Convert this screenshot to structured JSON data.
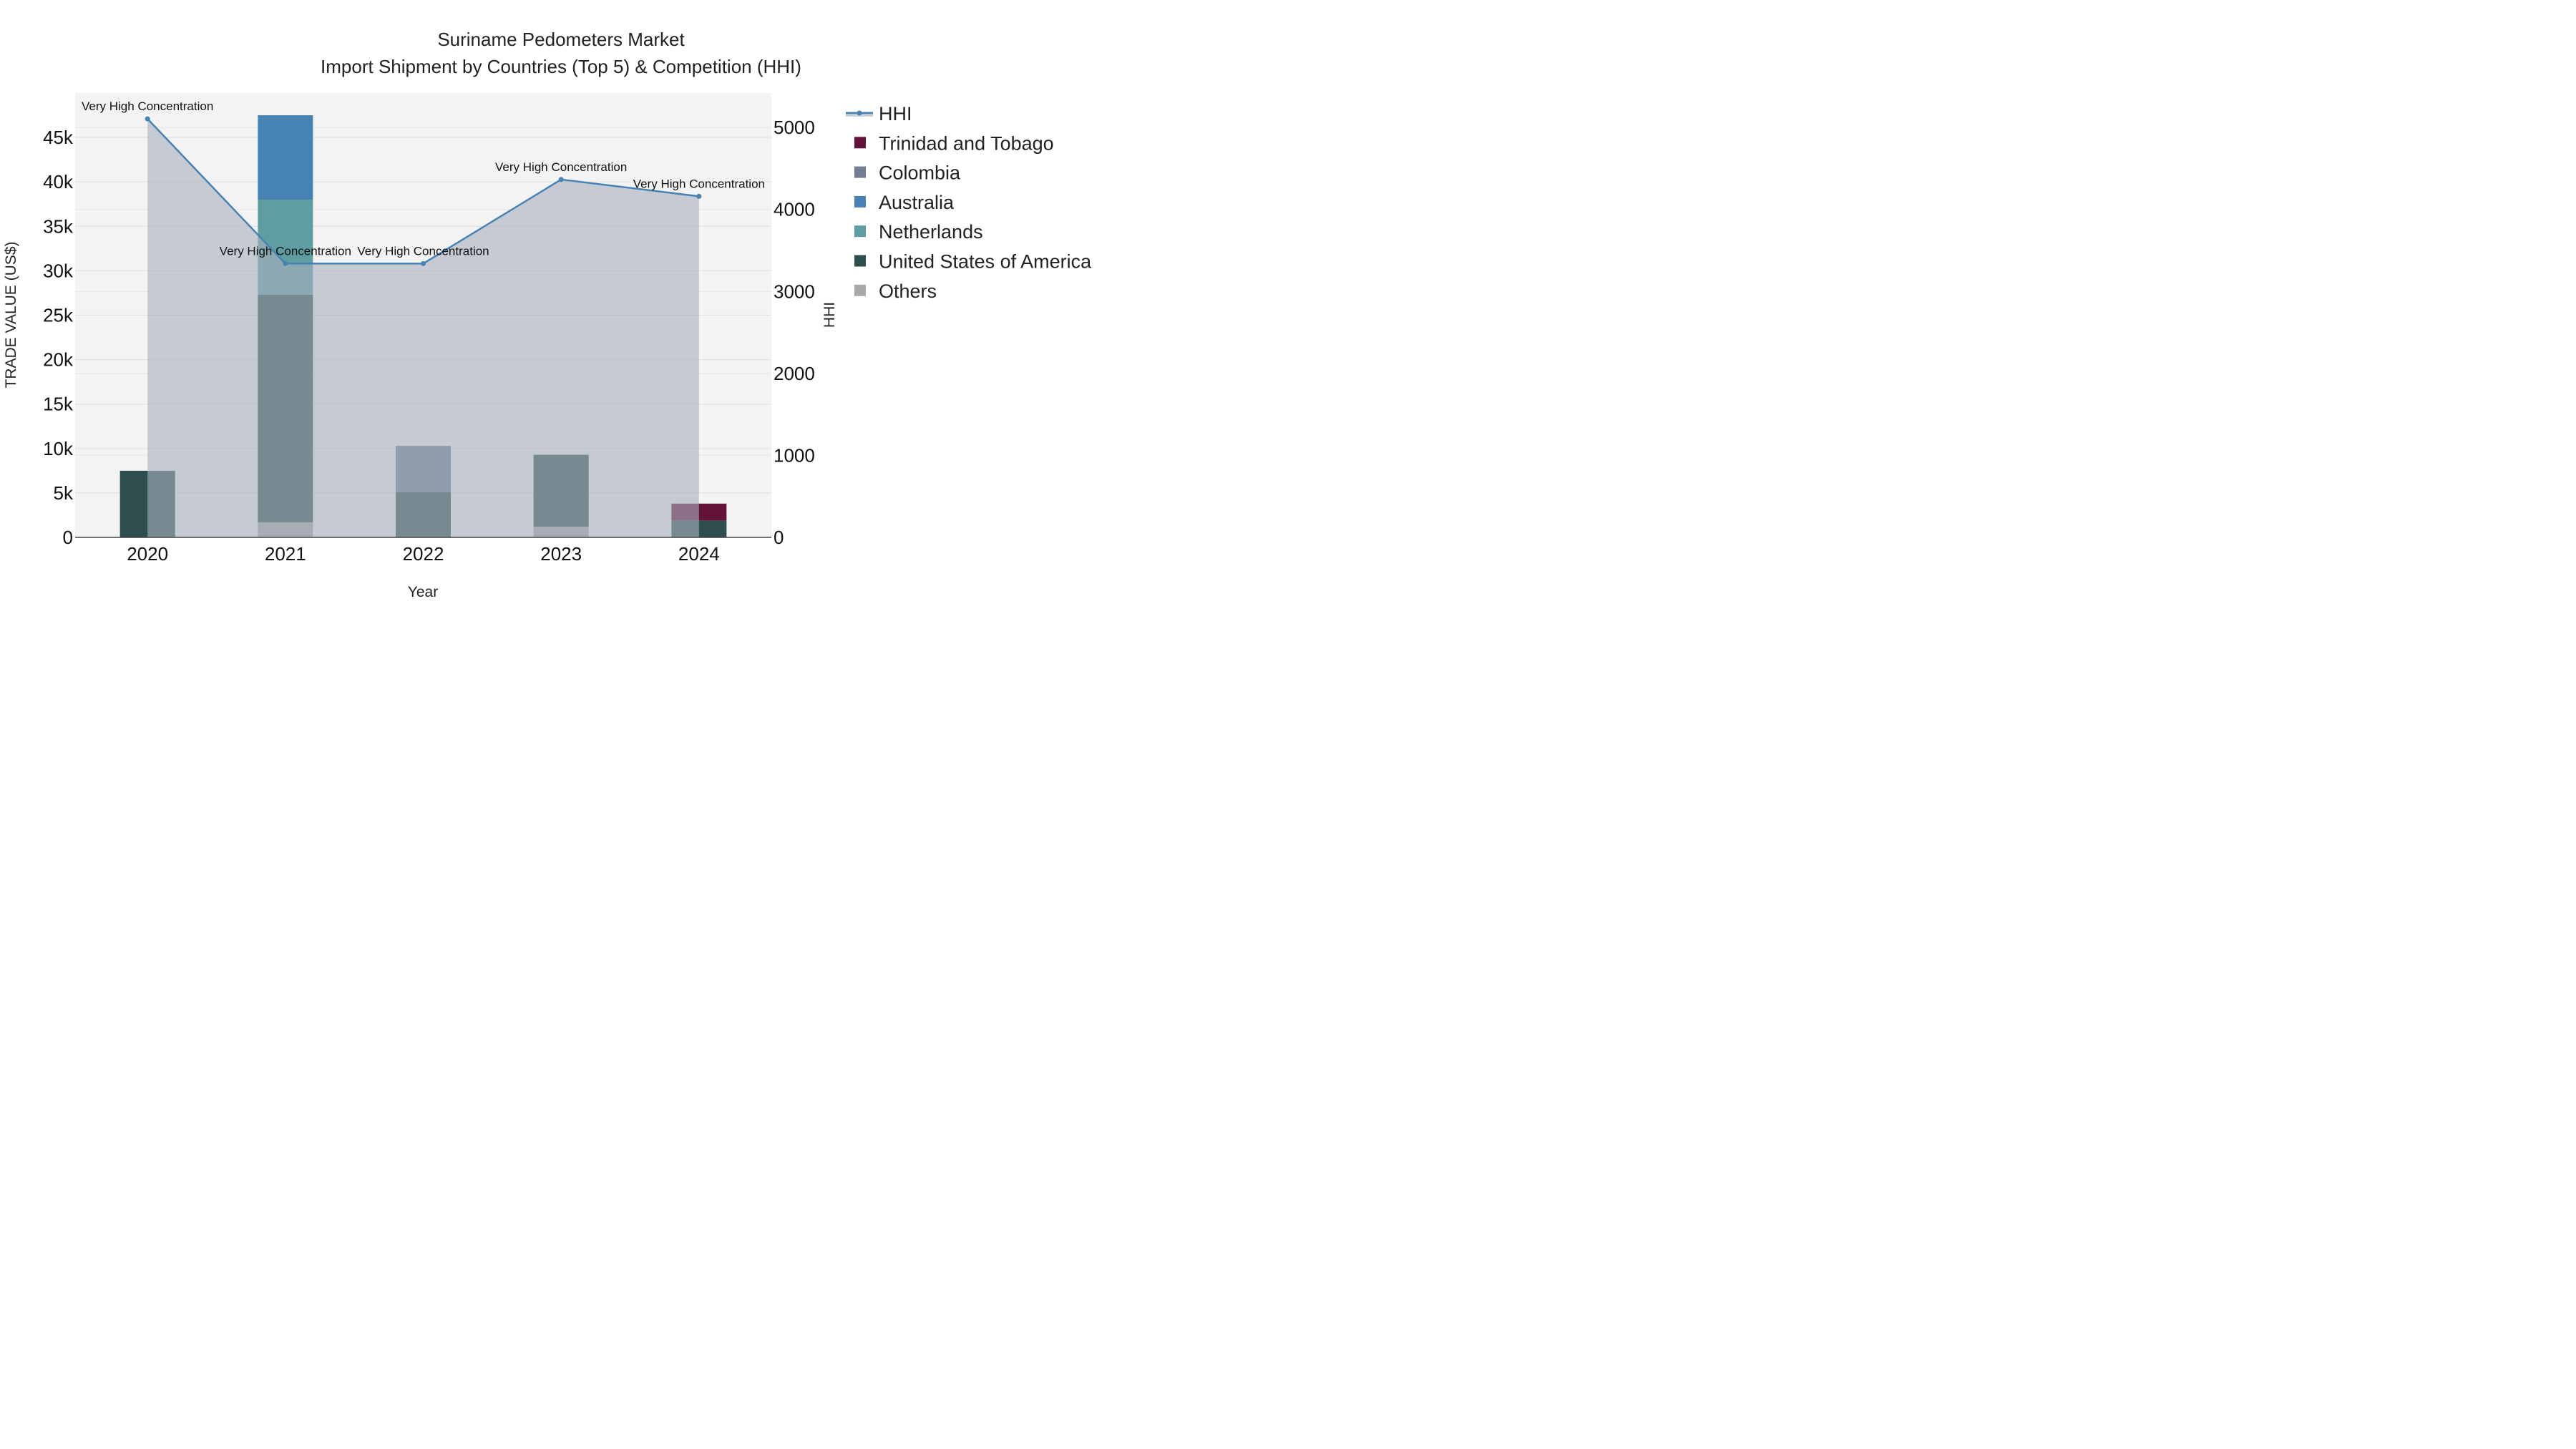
{
  "chart_data": {
    "type": "bar",
    "title": "Suriname Pedometers Market",
    "subtitle": "Import Shipment by Countries (Top 5) & Competition (HHI)",
    "xlabel": "Year",
    "ylabel": "TRADE VALUE (US$)",
    "y2label": "HHI",
    "categories": [
      "2020",
      "2021",
      "2022",
      "2023",
      "2024"
    ],
    "ylim": [
      0,
      50000
    ],
    "y2lim": [
      0,
      5420
    ],
    "yticks": [
      0,
      5000,
      10000,
      15000,
      20000,
      25000,
      30000,
      35000,
      40000,
      45000
    ],
    "ytick_labels": [
      "0",
      "5k",
      "10k",
      "15k",
      "20k",
      "25k",
      "30k",
      "35k",
      "40k",
      "45k"
    ],
    "y2ticks": [
      0,
      1000,
      2000,
      3000,
      4000,
      5000
    ],
    "y2tick_labels": [
      "0",
      "1000",
      "2000",
      "3000",
      "4000",
      "5000"
    ],
    "grid": true,
    "legend_position": "right",
    "series": [
      {
        "name": "Others",
        "color": "#a9a9a9",
        "values": [
          0,
          1700,
          0,
          1200,
          0
        ]
      },
      {
        "name": "United States of America",
        "color": "#2f4f4f",
        "values": [
          7500,
          25600,
          5100,
          8100,
          1900
        ]
      },
      {
        "name": "Netherlands",
        "color": "#5f9ea0",
        "values": [
          0,
          10700,
          0,
          0,
          0
        ]
      },
      {
        "name": "Australia",
        "color": "#4682b4",
        "values": [
          0,
          9500,
          0,
          0,
          0
        ]
      },
      {
        "name": "Colombia",
        "color": "#708090",
        "values": [
          0,
          0,
          5200,
          0,
          0
        ]
      },
      {
        "name": "Trinidad and Tobago",
        "color": "#641338",
        "values": [
          0,
          0,
          0,
          0,
          1900
        ]
      }
    ],
    "hhi": {
      "name": "HHI",
      "color": "#4682b4",
      "values": [
        5105,
        3340,
        3340,
        4365,
        4160
      ],
      "annotations": [
        "Very High Concentration",
        "Very High Concentration",
        "Very High Concentration",
        "Very High Concentration",
        "Very High Concentration"
      ]
    },
    "legend_order": [
      "HHI",
      "Trinidad and Tobago",
      "Colombia",
      "Australia",
      "Netherlands",
      "United States of America",
      "Others"
    ]
  }
}
